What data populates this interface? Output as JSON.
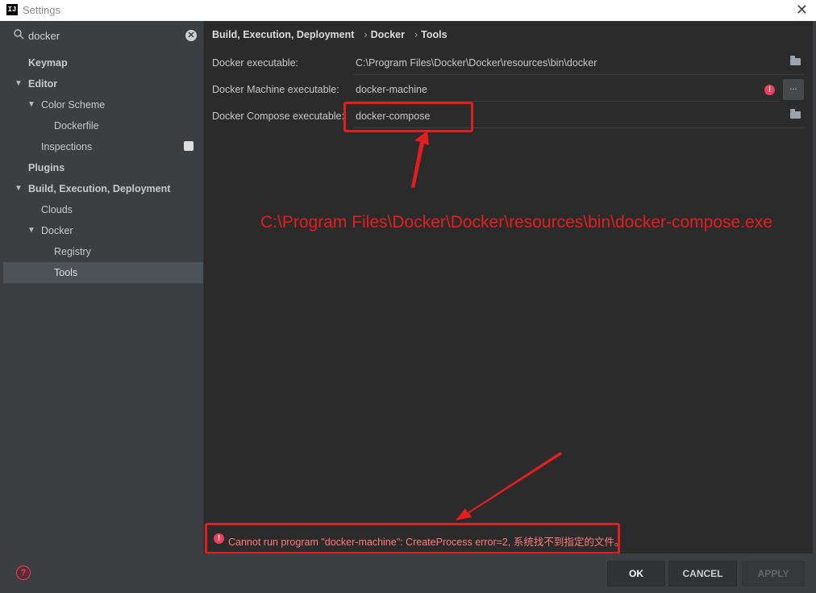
{
  "window": {
    "title": "Settings",
    "app_icon_text": "IJ",
    "close_glyph": "✕"
  },
  "search": {
    "value": "docker",
    "icon": "search-icon",
    "clear": "✕"
  },
  "tree": {
    "keymap": "Keymap",
    "editor": "Editor",
    "color_scheme": "Color Scheme",
    "dockerfile": "Dockerfile",
    "inspections": "Inspections",
    "plugins": "Plugins",
    "build": "Build, Execution, Deployment",
    "clouds": "Clouds",
    "docker": "Docker",
    "registry": "Registry",
    "tools": "Tools"
  },
  "breadcrumb": [
    "Build, Execution, Deployment",
    "Docker",
    "Tools"
  ],
  "breadcrumb_sep": "›",
  "fields": {
    "docker_exe": {
      "label": "Docker executable:",
      "value": "C:\\Program Files\\Docker\\Docker\\resources\\bin\\docker"
    },
    "machine_exe": {
      "label": "Docker Machine executable:",
      "value": "docker-machine"
    },
    "compose_exe": {
      "label": "Docker Compose executable:",
      "value": "docker-compose"
    }
  },
  "ellipsis": "...",
  "error_glyph": "!",
  "annotation": "C:\\Program Files\\Docker\\Docker\\resources\\bin\\docker-compose.exe",
  "error_message": "Cannot run program \"docker-machine\": CreateProcess error=2, 系统找不到指定的文件。",
  "help_glyph": "?",
  "buttons": {
    "ok": "OK",
    "cancel": "CANCEL",
    "apply": "APPLY"
  },
  "colors": {
    "annotation_red": "#e31e1e",
    "error_pink": "#e8415c"
  }
}
